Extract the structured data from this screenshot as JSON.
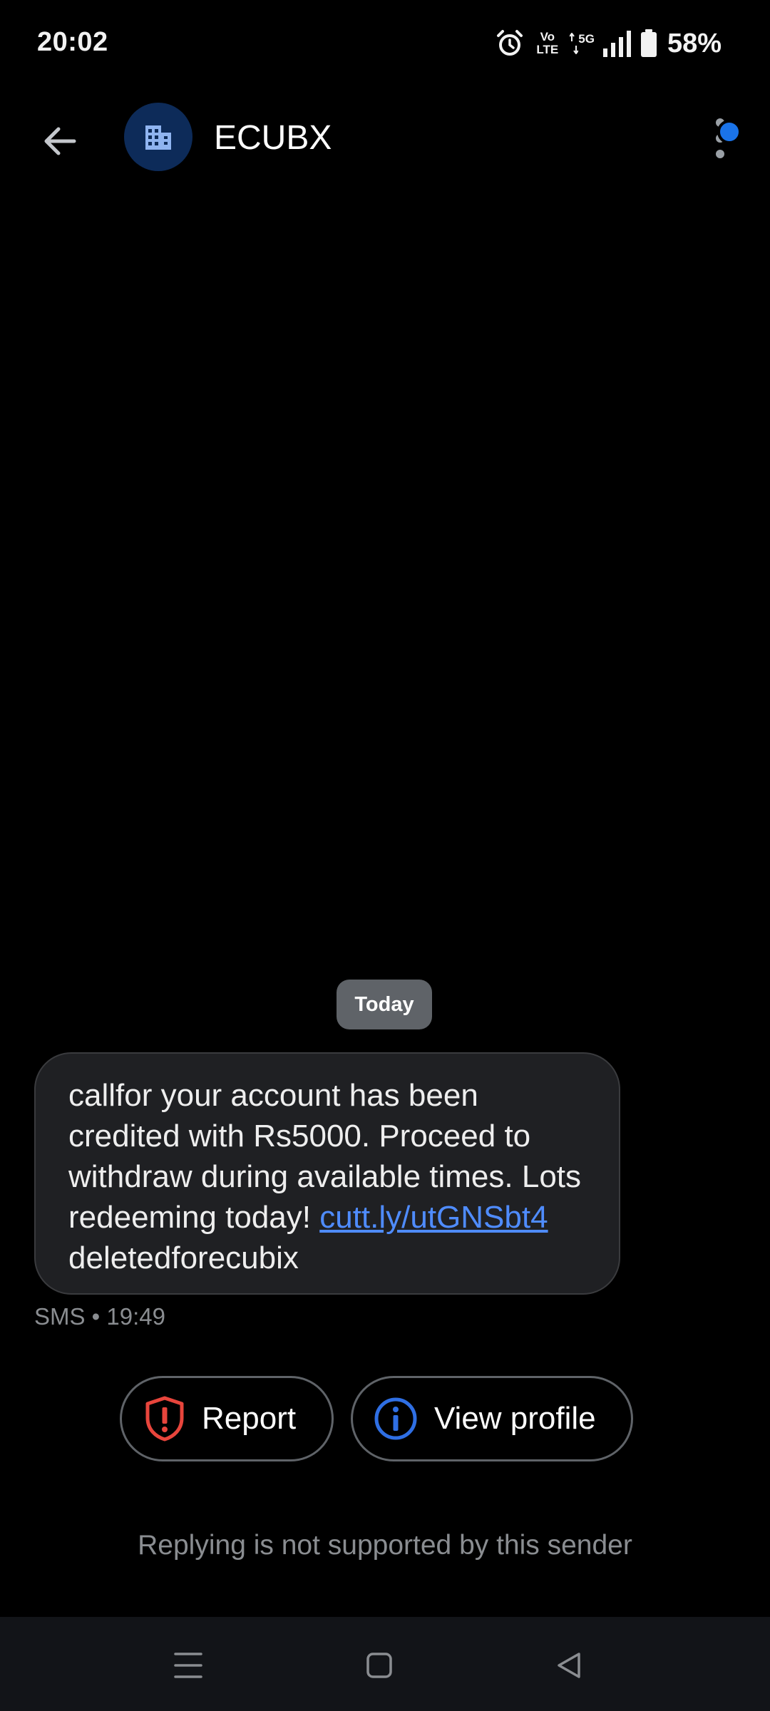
{
  "status_bar": {
    "time": "20:02",
    "volte_top": "Vo",
    "volte_bottom": "LTE",
    "network": "5G",
    "battery": "58%",
    "icons": [
      "alarm-icon",
      "volte-icon",
      "5g-icon",
      "signal-icon",
      "battery-icon"
    ]
  },
  "header": {
    "contact_name": "ECUBX",
    "avatar_icon": "building-icon",
    "back_icon": "arrow-left-icon",
    "menu_icon": "more-vert-icon",
    "badge_color": "#1a73e8"
  },
  "conversation": {
    "date_label": "Today",
    "message": {
      "text_before_link": "callfor your account has been credited with Rs5000. Proceed to withdraw during available times. Lots redeeming today! ",
      "link_text": "cutt.ly/utGNSbt4",
      "text_after_link": " deletedforecubix",
      "meta": "SMS • 19:49"
    }
  },
  "actions": {
    "report_label": "Report",
    "report_icon": "shield-alert-icon",
    "report_color": "#e8453c",
    "view_profile_label": "View profile",
    "view_profile_icon": "info-icon",
    "view_profile_color": "#2f6fe4"
  },
  "footer": {
    "reply_note": "Replying is not supported by this sender"
  },
  "nav_bar": {
    "icons": [
      "recents-icon",
      "home-icon",
      "back-icon"
    ]
  }
}
